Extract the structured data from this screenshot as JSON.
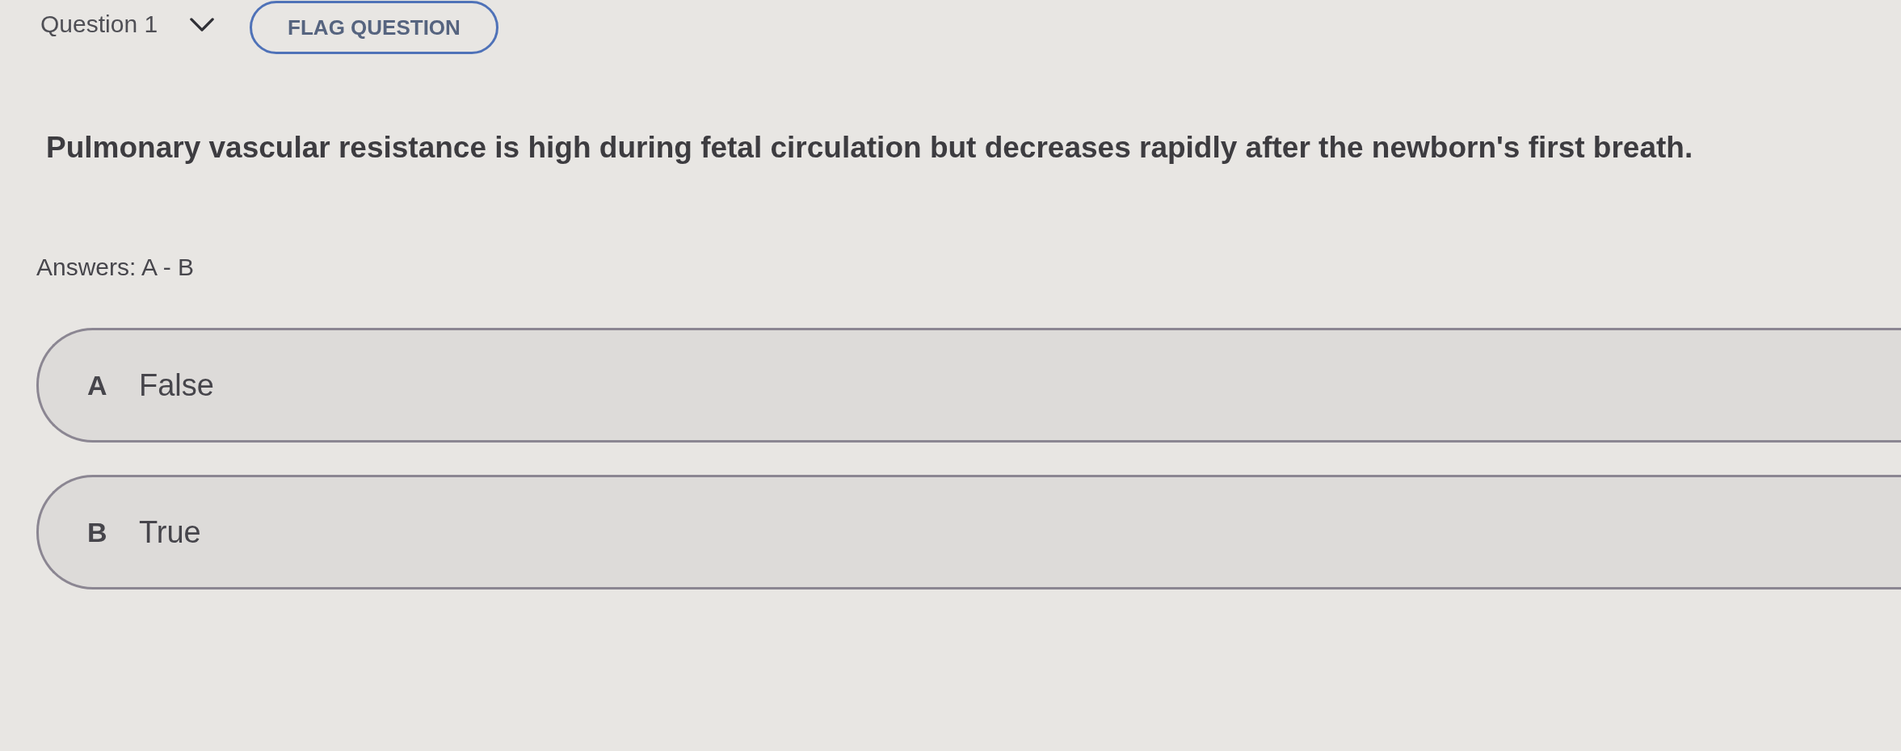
{
  "header": {
    "question_label": "Question 1",
    "flag_button": "FLAG QUESTION"
  },
  "question": {
    "text": "Pulmonary vascular resistance is high during fetal circulation but decreases rapidly after the newborn's first breath."
  },
  "answers_summary": "Answers: A - B",
  "options": [
    {
      "letter": "A",
      "label": "False"
    },
    {
      "letter": "B",
      "label": "True"
    }
  ]
}
